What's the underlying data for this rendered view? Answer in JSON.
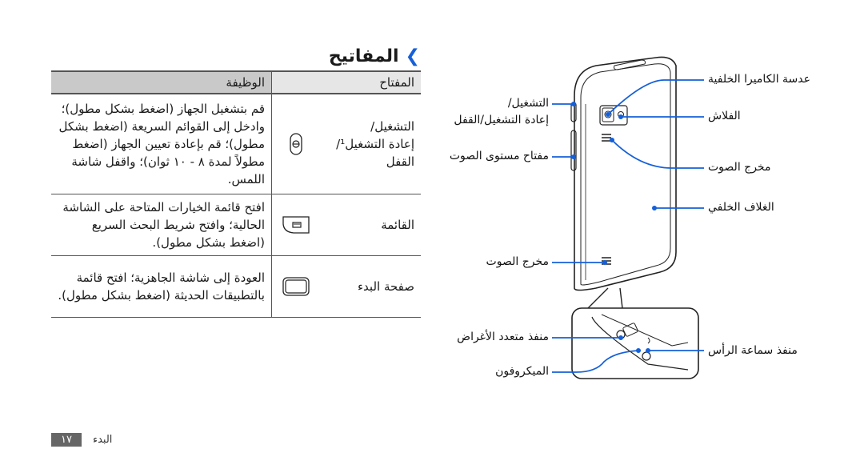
{
  "section": {
    "title": "المفاتيح",
    "chevron_icon": "chevron-right-icon",
    "accent_color": "#1560d8"
  },
  "table": {
    "headers": {
      "key": "المفتاح",
      "function": "الوظيفة"
    },
    "rows": [
      {
        "icon": "power-key-icon",
        "key": "التشغيل/\nإعادة التشغيل¹/\nالقفل",
        "function": "قم بتشغيل الجهاز (اضغط بشكل مطول)؛ وادخل إلى القوائم السريعة (اضغط بشكل مطول)؛ قم بإعادة تعيين الجهاز (اضغط مطولاً لمدة ٨ - ١٠ ثوان)؛ واقفل شاشة اللمس."
      },
      {
        "icon": "menu-key-icon",
        "key": "القائمة",
        "function": "افتح قائمة الخيارات المتاحة على الشاشة الحالية؛ وافتح شريط البحث السريع (اضغط بشكل مطول)."
      },
      {
        "icon": "home-key-icon",
        "key": "صفحة البدء",
        "function": "العودة إلى شاشة الجاهزية؛ افتح قائمة بالتطبيقات الحديثة (اضغط بشكل مطول)."
      }
    ]
  },
  "diagram": {
    "labels": {
      "rear_camera": "عدسة الكاميرا الخلفية",
      "flash": "الفلاش",
      "speaker_right": "مخرج الصوت",
      "back_cover": "الغلاف الخلفي",
      "power_key_line1": "التشغيل/",
      "power_key_line2": "إعادة التشغيل/القفل",
      "volume_key": "مفتاح مستوى الصوت",
      "speaker_left": "مخرج الصوت",
      "multifunction_jack": "منفذ متعدد الأغراض",
      "microphone": "الميكروفون",
      "headset_jack": "منفذ سماعة الرأس"
    },
    "callout_color": "#1560d8"
  },
  "footer": {
    "section_name": "البدء",
    "page_number": "١٧"
  }
}
